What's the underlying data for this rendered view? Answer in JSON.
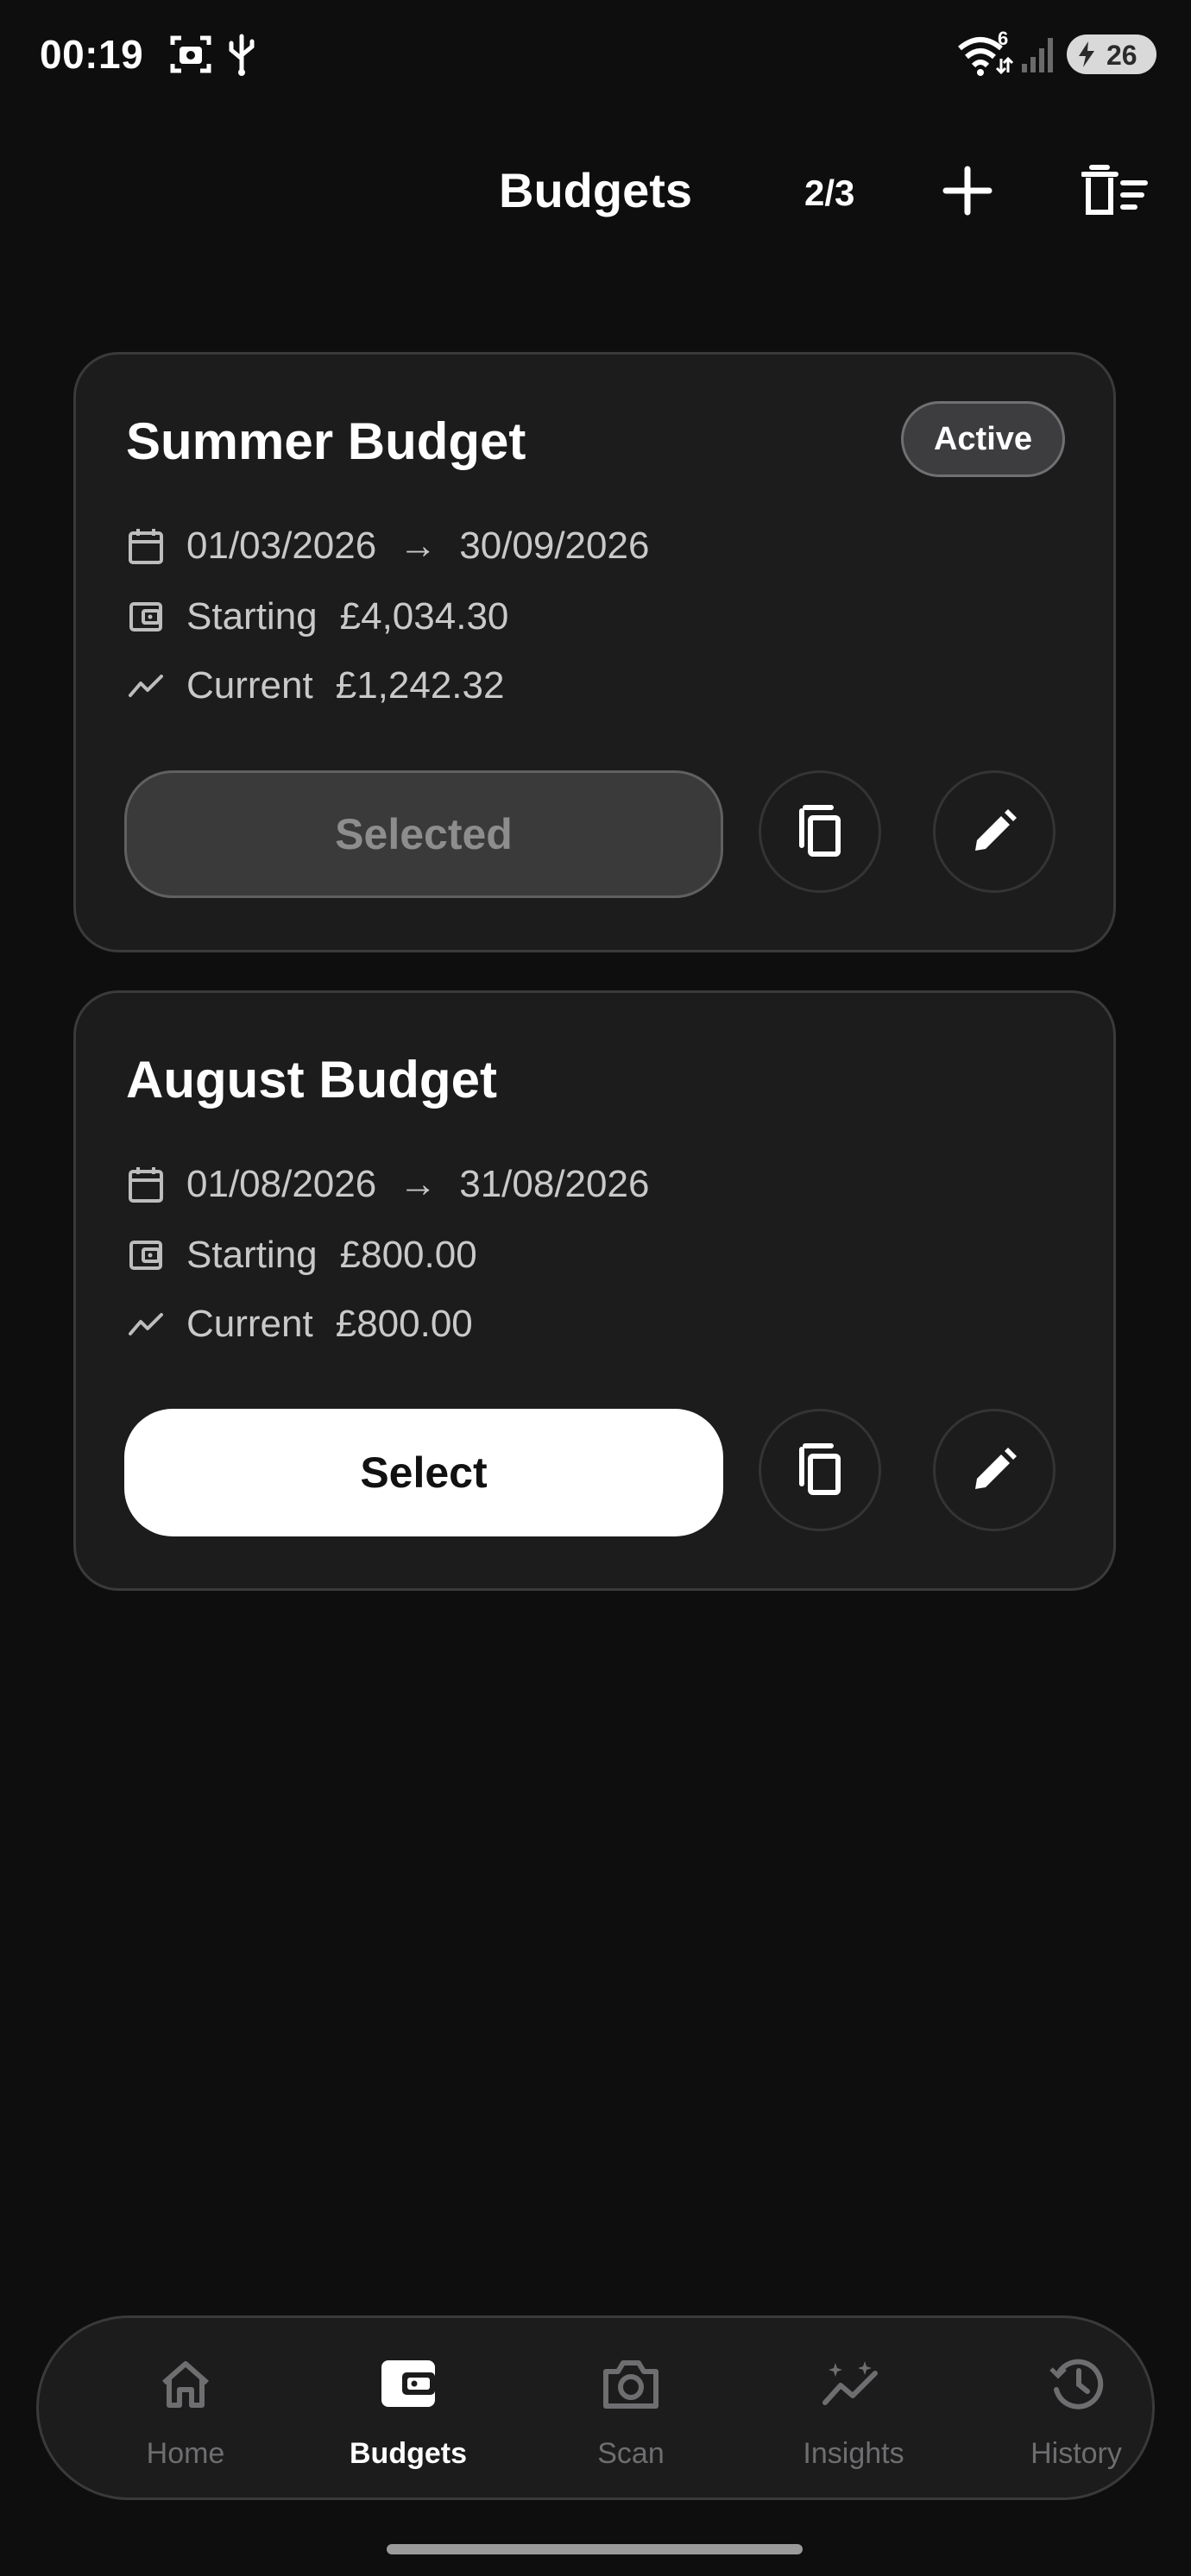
{
  "status_bar": {
    "time": "00:19",
    "wifi_badge": "6",
    "battery_percent": "26"
  },
  "header": {
    "title": "Budgets",
    "count": "2/3",
    "add_icon": "plus-icon",
    "delete_icon": "delete-list-icon"
  },
  "budgets": [
    {
      "name": "Summer Budget",
      "badge": "Active",
      "start_date": "01/03/2026",
      "arrow": "→",
      "end_date": "30/09/2026",
      "starting_label": "Starting",
      "starting_amount": "£4,034.30",
      "current_label": "Current",
      "current_amount": "£1,242.32",
      "button_label": "Selected"
    },
    {
      "name": "August Budget",
      "start_date": "01/08/2026",
      "arrow": "→",
      "end_date": "31/08/2026",
      "starting_label": "Starting",
      "starting_amount": "£800.00",
      "current_label": "Current",
      "current_amount": "£800.00",
      "button_label": "Select"
    }
  ],
  "nav": {
    "items": [
      {
        "label": "Home",
        "icon": "home-icon",
        "active": false
      },
      {
        "label": "Budgets",
        "icon": "wallet-icon",
        "active": true
      },
      {
        "label": "Scan",
        "icon": "camera-icon",
        "active": false
      },
      {
        "label": "Insights",
        "icon": "insights-icon",
        "active": false
      },
      {
        "label": "History",
        "icon": "history-icon",
        "active": false
      }
    ]
  },
  "colors": {
    "background": "#0e0e0e",
    "card": "#1c1c1d",
    "card_border": "#3a3a3c",
    "text_primary": "#ffffff",
    "text_secondary": "#c9c9c9",
    "nav_inactive": "#6e6e70"
  }
}
